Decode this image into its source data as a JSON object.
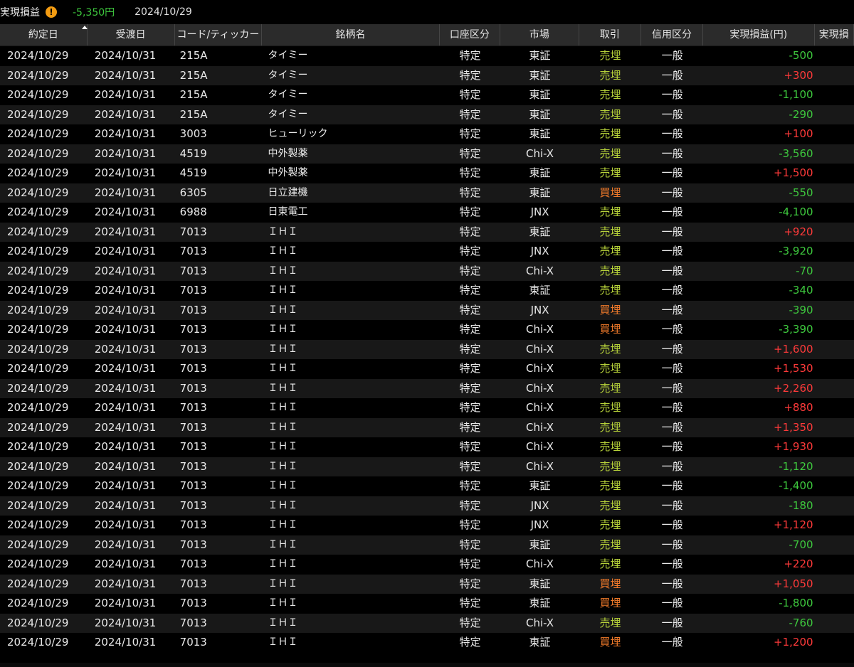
{
  "summary": {
    "label": "実現損益",
    "warning_icon": "exclamation-circle-icon",
    "value": "-5,350円",
    "date": "2024/10/29",
    "value_color": "#3ec93e"
  },
  "columns": [
    {
      "key": "trade_date",
      "label": "約定日",
      "width": 124
    },
    {
      "key": "delivery_date",
      "label": "受渡日",
      "width": 124
    },
    {
      "key": "code",
      "label": "コード/ティッカー",
      "width": 124
    },
    {
      "key": "name",
      "label": "銘柄名",
      "width": 252
    },
    {
      "key": "account",
      "label": "口座区分",
      "width": 86
    },
    {
      "key": "market",
      "label": "市場",
      "width": 112
    },
    {
      "key": "trade",
      "label": "取引",
      "width": 88
    },
    {
      "key": "credit",
      "label": "信用区分",
      "width": 88
    },
    {
      "key": "pnl",
      "label": "実現損益(円)",
      "width": 158
    },
    {
      "key": "extra",
      "label": "実現損",
      "width": 56
    }
  ],
  "sort": {
    "column": "trade_date",
    "direction": "asc",
    "icon": "sort-up-icon"
  },
  "colors": {
    "sell": "#b7d23a",
    "buy": "#f07a2a",
    "positive": "#ff3a3a",
    "negative": "#3ec93e"
  },
  "rows": [
    {
      "trade_date": "2024/10/29",
      "delivery_date": "2024/10/31",
      "code": "215A",
      "name": "タイミー",
      "account": "特定",
      "market": "東証",
      "trade": "売埋",
      "credit": "一般",
      "pnl": "-500"
    },
    {
      "trade_date": "2024/10/29",
      "delivery_date": "2024/10/31",
      "code": "215A",
      "name": "タイミー",
      "account": "特定",
      "market": "東証",
      "trade": "売埋",
      "credit": "一般",
      "pnl": "+300"
    },
    {
      "trade_date": "2024/10/29",
      "delivery_date": "2024/10/31",
      "code": "215A",
      "name": "タイミー",
      "account": "特定",
      "market": "東証",
      "trade": "売埋",
      "credit": "一般",
      "pnl": "-1,100"
    },
    {
      "trade_date": "2024/10/29",
      "delivery_date": "2024/10/31",
      "code": "215A",
      "name": "タイミー",
      "account": "特定",
      "market": "東証",
      "trade": "売埋",
      "credit": "一般",
      "pnl": "-290"
    },
    {
      "trade_date": "2024/10/29",
      "delivery_date": "2024/10/31",
      "code": "3003",
      "name": "ヒューリック",
      "account": "特定",
      "market": "東証",
      "trade": "売埋",
      "credit": "一般",
      "pnl": "+100"
    },
    {
      "trade_date": "2024/10/29",
      "delivery_date": "2024/10/31",
      "code": "4519",
      "name": "中外製薬",
      "account": "特定",
      "market": "Chi-X",
      "trade": "売埋",
      "credit": "一般",
      "pnl": "-3,560"
    },
    {
      "trade_date": "2024/10/29",
      "delivery_date": "2024/10/31",
      "code": "4519",
      "name": "中外製薬",
      "account": "特定",
      "market": "東証",
      "trade": "売埋",
      "credit": "一般",
      "pnl": "+1,500"
    },
    {
      "trade_date": "2024/10/29",
      "delivery_date": "2024/10/31",
      "code": "6305",
      "name": "日立建機",
      "account": "特定",
      "market": "東証",
      "trade": "買埋",
      "credit": "一般",
      "pnl": "-550"
    },
    {
      "trade_date": "2024/10/29",
      "delivery_date": "2024/10/31",
      "code": "6988",
      "name": "日東電工",
      "account": "特定",
      "market": "JNX",
      "trade": "売埋",
      "credit": "一般",
      "pnl": "-4,100"
    },
    {
      "trade_date": "2024/10/29",
      "delivery_date": "2024/10/31",
      "code": "7013",
      "name": "ＩＨＩ",
      "account": "特定",
      "market": "東証",
      "trade": "売埋",
      "credit": "一般",
      "pnl": "+920"
    },
    {
      "trade_date": "2024/10/29",
      "delivery_date": "2024/10/31",
      "code": "7013",
      "name": "ＩＨＩ",
      "account": "特定",
      "market": "JNX",
      "trade": "売埋",
      "credit": "一般",
      "pnl": "-3,920"
    },
    {
      "trade_date": "2024/10/29",
      "delivery_date": "2024/10/31",
      "code": "7013",
      "name": "ＩＨＩ",
      "account": "特定",
      "market": "Chi-X",
      "trade": "売埋",
      "credit": "一般",
      "pnl": "-70"
    },
    {
      "trade_date": "2024/10/29",
      "delivery_date": "2024/10/31",
      "code": "7013",
      "name": "ＩＨＩ",
      "account": "特定",
      "market": "東証",
      "trade": "売埋",
      "credit": "一般",
      "pnl": "-340"
    },
    {
      "trade_date": "2024/10/29",
      "delivery_date": "2024/10/31",
      "code": "7013",
      "name": "ＩＨＩ",
      "account": "特定",
      "market": "JNX",
      "trade": "買埋",
      "credit": "一般",
      "pnl": "-390"
    },
    {
      "trade_date": "2024/10/29",
      "delivery_date": "2024/10/31",
      "code": "7013",
      "name": "ＩＨＩ",
      "account": "特定",
      "market": "Chi-X",
      "trade": "買埋",
      "credit": "一般",
      "pnl": "-3,390"
    },
    {
      "trade_date": "2024/10/29",
      "delivery_date": "2024/10/31",
      "code": "7013",
      "name": "ＩＨＩ",
      "account": "特定",
      "market": "Chi-X",
      "trade": "売埋",
      "credit": "一般",
      "pnl": "+1,600"
    },
    {
      "trade_date": "2024/10/29",
      "delivery_date": "2024/10/31",
      "code": "7013",
      "name": "ＩＨＩ",
      "account": "特定",
      "market": "Chi-X",
      "trade": "売埋",
      "credit": "一般",
      "pnl": "+1,530"
    },
    {
      "trade_date": "2024/10/29",
      "delivery_date": "2024/10/31",
      "code": "7013",
      "name": "ＩＨＩ",
      "account": "特定",
      "market": "Chi-X",
      "trade": "売埋",
      "credit": "一般",
      "pnl": "+2,260"
    },
    {
      "trade_date": "2024/10/29",
      "delivery_date": "2024/10/31",
      "code": "7013",
      "name": "ＩＨＩ",
      "account": "特定",
      "market": "Chi-X",
      "trade": "売埋",
      "credit": "一般",
      "pnl": "+880"
    },
    {
      "trade_date": "2024/10/29",
      "delivery_date": "2024/10/31",
      "code": "7013",
      "name": "ＩＨＩ",
      "account": "特定",
      "market": "Chi-X",
      "trade": "売埋",
      "credit": "一般",
      "pnl": "+1,350"
    },
    {
      "trade_date": "2024/10/29",
      "delivery_date": "2024/10/31",
      "code": "7013",
      "name": "ＩＨＩ",
      "account": "特定",
      "market": "Chi-X",
      "trade": "売埋",
      "credit": "一般",
      "pnl": "+1,930"
    },
    {
      "trade_date": "2024/10/29",
      "delivery_date": "2024/10/31",
      "code": "7013",
      "name": "ＩＨＩ",
      "account": "特定",
      "market": "Chi-X",
      "trade": "売埋",
      "credit": "一般",
      "pnl": "-1,120"
    },
    {
      "trade_date": "2024/10/29",
      "delivery_date": "2024/10/31",
      "code": "7013",
      "name": "ＩＨＩ",
      "account": "特定",
      "market": "東証",
      "trade": "売埋",
      "credit": "一般",
      "pnl": "-1,400"
    },
    {
      "trade_date": "2024/10/29",
      "delivery_date": "2024/10/31",
      "code": "7013",
      "name": "ＩＨＩ",
      "account": "特定",
      "market": "JNX",
      "trade": "売埋",
      "credit": "一般",
      "pnl": "-180"
    },
    {
      "trade_date": "2024/10/29",
      "delivery_date": "2024/10/31",
      "code": "7013",
      "name": "ＩＨＩ",
      "account": "特定",
      "market": "JNX",
      "trade": "売埋",
      "credit": "一般",
      "pnl": "+1,120"
    },
    {
      "trade_date": "2024/10/29",
      "delivery_date": "2024/10/31",
      "code": "7013",
      "name": "ＩＨＩ",
      "account": "特定",
      "market": "東証",
      "trade": "売埋",
      "credit": "一般",
      "pnl": "-700"
    },
    {
      "trade_date": "2024/10/29",
      "delivery_date": "2024/10/31",
      "code": "7013",
      "name": "ＩＨＩ",
      "account": "特定",
      "market": "Chi-X",
      "trade": "売埋",
      "credit": "一般",
      "pnl": "+220"
    },
    {
      "trade_date": "2024/10/29",
      "delivery_date": "2024/10/31",
      "code": "7013",
      "name": "ＩＨＩ",
      "account": "特定",
      "market": "東証",
      "trade": "買埋",
      "credit": "一般",
      "pnl": "+1,050"
    },
    {
      "trade_date": "2024/10/29",
      "delivery_date": "2024/10/31",
      "code": "7013",
      "name": "ＩＨＩ",
      "account": "特定",
      "market": "東証",
      "trade": "買埋",
      "credit": "一般",
      "pnl": "-1,800"
    },
    {
      "trade_date": "2024/10/29",
      "delivery_date": "2024/10/31",
      "code": "7013",
      "name": "ＩＨＩ",
      "account": "特定",
      "market": "Chi-X",
      "trade": "売埋",
      "credit": "一般",
      "pnl": "-760"
    },
    {
      "trade_date": "2024/10/29",
      "delivery_date": "2024/10/31",
      "code": "7013",
      "name": "ＩＨＩ",
      "account": "特定",
      "market": "東証",
      "trade": "買埋",
      "credit": "一般",
      "pnl": "+1,200"
    }
  ]
}
